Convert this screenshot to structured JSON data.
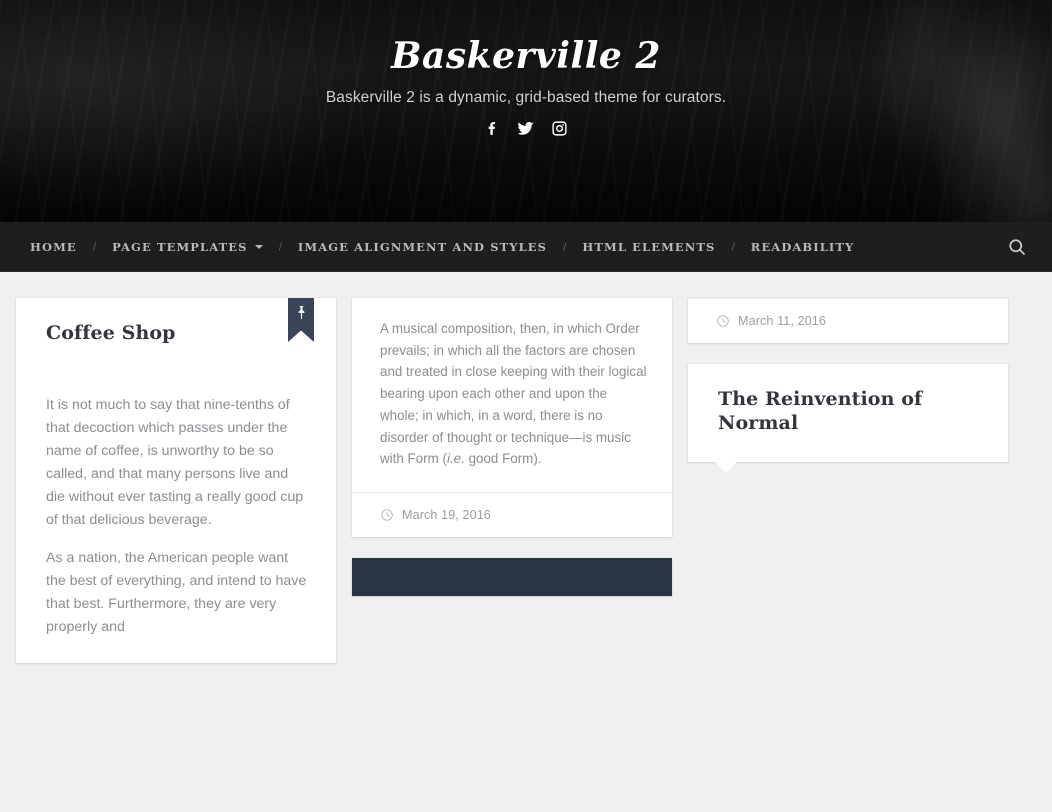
{
  "site": {
    "title": "Baskerville 2",
    "tagline": "Baskerville 2 is a dynamic, grid-based theme for curators.",
    "social": [
      {
        "name": "facebook-icon",
        "label": "Facebook"
      },
      {
        "name": "twitter-icon",
        "label": "Twitter"
      },
      {
        "name": "instagram-icon",
        "label": "Instagram"
      }
    ]
  },
  "nav": {
    "items": [
      {
        "label": "Home",
        "has_dropdown": false
      },
      {
        "label": "Page Templates",
        "has_dropdown": true
      },
      {
        "label": "Image Alignment and Styles",
        "has_dropdown": false
      },
      {
        "label": "HTML Elements",
        "has_dropdown": false
      },
      {
        "label": "Readability",
        "has_dropdown": false
      }
    ],
    "separator": "/",
    "search_label": "Search"
  },
  "colors": {
    "page_background": "#f0f0f0",
    "nav_background": "#1d1e20",
    "ribbon": "#3a4458",
    "dark_card": "#2b3442",
    "card_title": "#32363c",
    "body_text": "#8a8d92",
    "meta_text": "#9a9da1"
  },
  "columns": [
    {
      "cards": [
        {
          "id": "coffee-shop",
          "title": "Coffee Shop",
          "pinned": true,
          "pin_icon": "pin-icon",
          "photo": "coffee-shop-interior-photo",
          "paragraphs": [
            "It is not much to say that nine-tenths of that decoction which passes under the name of coffee, is unworthy to be so called, and that many persons live and die without ever tasting a really good cup of that delicious beverage.",
            "As a nation, the American people want the best of everything, and intend to have that best. Furthermore, they are very properly and"
          ]
        }
      ]
    },
    {
      "cards": [
        {
          "id": "musical-composition",
          "photo": "audio-mixing-console-photo",
          "excerpt_lead": "A musical composition, then, in which Order prevails; in which all the factors are chosen and treated in close keeping with their logical bearing upon each other and upon the whole; in which, in a word, there is no disorder of thought or technique—is music with Form (",
          "excerpt_em": "i.e.",
          "excerpt_tail": " good Form).",
          "date": "March 19, 2016",
          "date_icon": "clock-icon"
        },
        {
          "id": "dark-card",
          "variant": "dark"
        }
      ]
    },
    {
      "cards": [
        {
          "id": "workbench",
          "photo": "workbench-compass-photo",
          "date": "March 11, 2016",
          "date_icon": "clock-icon"
        },
        {
          "id": "reinvention-of-normal",
          "title": "The Reinvention of Normal",
          "photo": "man-with-tubes-photo",
          "actions": [
            {
              "name": "favorite-button",
              "icon": "heart-icon"
            },
            {
              "name": "read-later-button",
              "icon": "clock-icon"
            }
          ]
        }
      ]
    }
  ]
}
